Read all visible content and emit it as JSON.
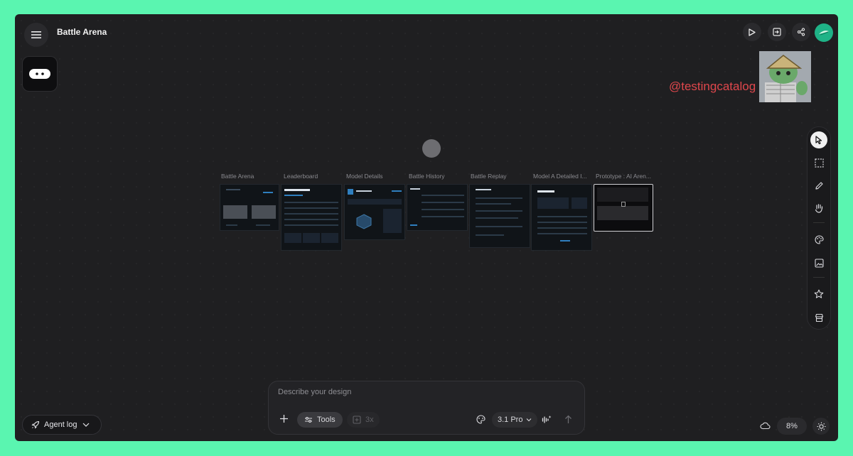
{
  "header": {
    "title": "Battle Arena",
    "actions": [
      "play-icon",
      "export-icon",
      "share-icon",
      "avatar"
    ]
  },
  "watermark": "@testingcatalog",
  "canvas": {
    "screens": [
      {
        "label": "Battle Arena"
      },
      {
        "label": "Leaderboard"
      },
      {
        "label": "Model Details"
      },
      {
        "label": "Battle History"
      },
      {
        "label": "Battle Replay"
      },
      {
        "label": "Model A Detailed I..."
      },
      {
        "label": "Prototype : AI Aren..."
      }
    ]
  },
  "right_toolbar": [
    "select-icon",
    "marquee-icon",
    "pencil-icon",
    "hand-icon",
    "palette-icon",
    "image-icon",
    "star-icon",
    "store-icon"
  ],
  "prompt": {
    "placeholder": "Describe your design",
    "tools_label": "Tools",
    "count_label": "3x",
    "model_label": "3.1 Pro"
  },
  "bottom": {
    "agent_log_label": "Agent log",
    "zoom_label": "8%"
  },
  "colors": {
    "frame": "#5af5b0",
    "canvas": "#1f1f21",
    "accent": "#1fb387",
    "watermark": "#e0474c"
  }
}
